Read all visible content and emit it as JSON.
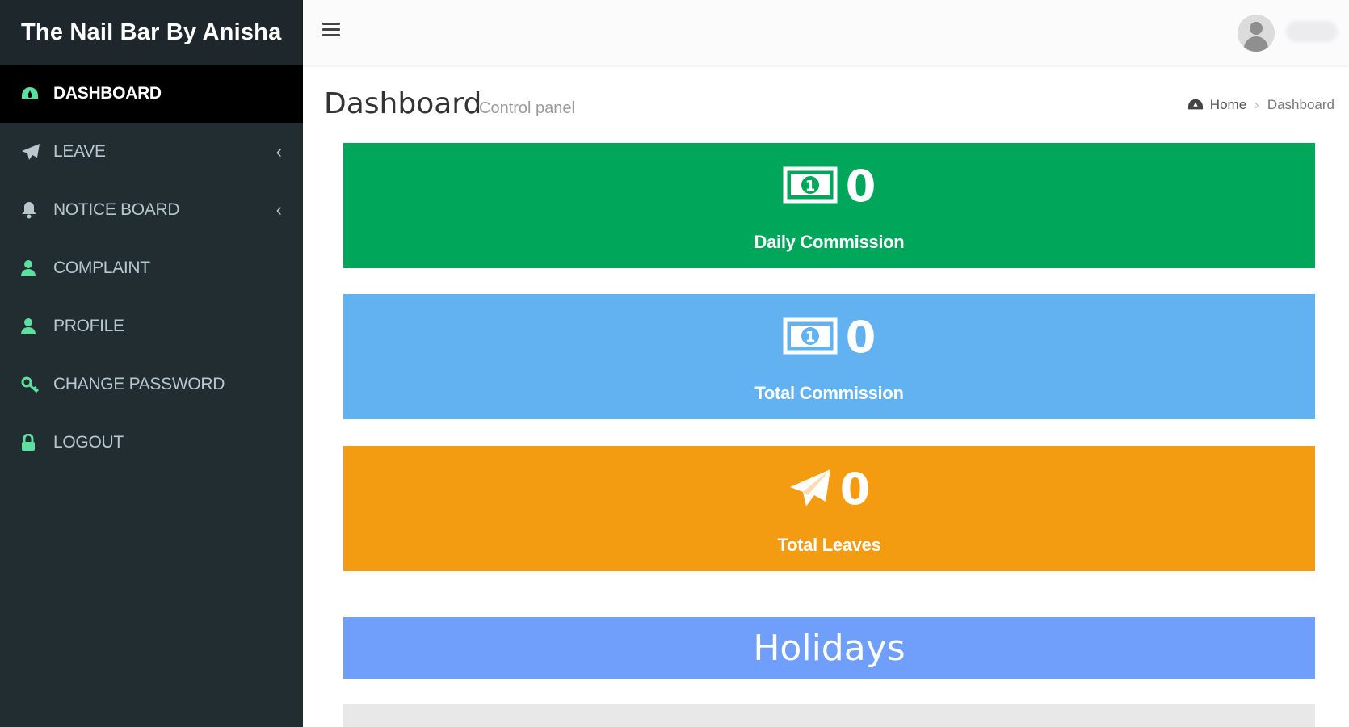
{
  "brand": {
    "title": "The Nail Bar By Anisha"
  },
  "sidebar": {
    "items": [
      {
        "label": "DASHBOARD",
        "icon": "dashboard-icon",
        "active": true
      },
      {
        "label": "LEAVE",
        "icon": "paper-plane-icon",
        "has_children": true
      },
      {
        "label": "NOTICE BOARD",
        "icon": "bell-icon",
        "has_children": true
      },
      {
        "label": "COMPLAINT",
        "icon": "user-icon"
      },
      {
        "label": "PROFILE",
        "icon": "user-icon"
      },
      {
        "label": "CHANGE PASSWORD",
        "icon": "key-icon"
      },
      {
        "label": "LOGOUT",
        "icon": "lock-icon"
      }
    ],
    "icon_color": "#5ce0a0"
  },
  "header": {
    "avatar_icon": "user-avatar-icon"
  },
  "content": {
    "title": "Dashboard",
    "subtitle": "Control panel",
    "breadcrumb": {
      "home": "Home",
      "current": "Dashboard"
    }
  },
  "stats": [
    {
      "value": "0",
      "label": "Daily Commission",
      "icon": "money-bill-icon",
      "color": "#00a65a"
    },
    {
      "value": "0",
      "label": "Total Commission",
      "icon": "money-bill-icon",
      "color": "#62b2f2"
    },
    {
      "value": "0",
      "label": "Total Leaves",
      "icon": "paper-plane-icon",
      "color": "#f39c12"
    }
  ],
  "holidays": {
    "title": "Holidays"
  }
}
